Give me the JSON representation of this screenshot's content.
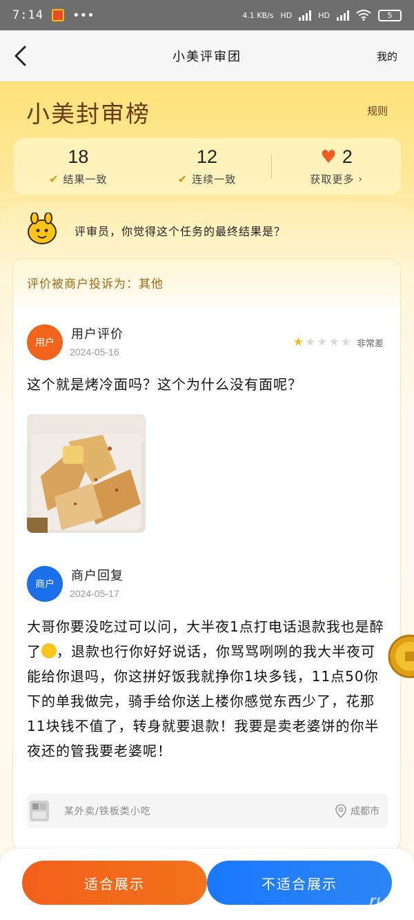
{
  "status_bar": {
    "time": "7:14",
    "network_speed": "4.1 KB/s",
    "hd1": "HD",
    "hd2": "HD",
    "battery": "5"
  },
  "nav": {
    "title": "小美评审团",
    "mine": "我的"
  },
  "hero": {
    "title": "小美封审榜",
    "rules": "规则",
    "stats": [
      {
        "value": "18",
        "label": "结果一致"
      },
      {
        "value": "12",
        "label": "连续一致"
      },
      {
        "value": "2",
        "label": "获取更多"
      }
    ]
  },
  "prompt": "评审员，你觉得这个任务的最终结果是？",
  "complaint": "评价被商户投诉为：其他",
  "review": {
    "avatar_label": "用户",
    "author": "用户评价",
    "date": "2024-05-16",
    "rating_stars": 1,
    "rating_text": "非常差",
    "text": "这个就是烤冷面吗？这个为什么没有面呢？"
  },
  "reply": {
    "avatar_label": "商户",
    "author": "商户回复",
    "date": "2024-05-17",
    "text_before_emoji": "大哥你要没吃过可以问，大半夜1点打电话退款我也是醉了",
    "text_after_emoji": "，退款也行你好好说话，你骂骂咧咧的我大半夜可能给你退吗，你这拼好饭我就挣你1块多钱，11点50你下的单我做完，骑手给你送上楼你感觉东西少了，花那11块钱不值了，转身就要退款！我要是卖老婆饼的你半夜还的管我要老婆呢！"
  },
  "store": {
    "name": "某外卖/铁板类小吃",
    "location": "成都市"
  },
  "buttons": {
    "suitable": "适合展示",
    "unsuitable": "不适合展示"
  },
  "colors": {
    "accent_orange": "#f2631b",
    "accent_blue": "#1b6fe8",
    "hero_yellow": "#ffe27a",
    "title_brown": "#6b3a15"
  }
}
